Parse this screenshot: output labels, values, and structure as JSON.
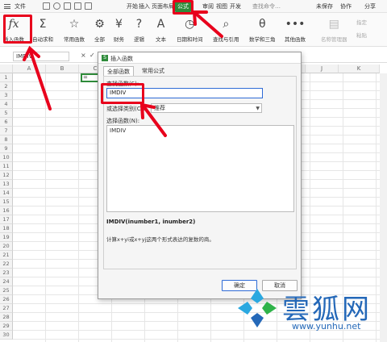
{
  "menubar": {
    "file": "文件",
    "tabs": [
      "开始",
      "插入",
      "页面布局",
      "公式",
      "审阅",
      "视图",
      "开发"
    ],
    "search_placeholder": "查找命令…",
    "unsaved": "未保存",
    "collab": "协作",
    "share": "分享"
  },
  "ribbon": {
    "buttons": [
      {
        "label": "插入函数",
        "icon": "fx-icon"
      },
      {
        "label": "自动求和",
        "icon": "sigma-icon"
      },
      {
        "label": "常用函数",
        "icon": "star-icon"
      },
      {
        "label": "全部",
        "icon": "gear-icon"
      },
      {
        "label": "财务",
        "icon": "finance-icon"
      },
      {
        "label": "逻辑",
        "icon": "logic-icon"
      },
      {
        "label": "文本",
        "icon": "text-icon"
      },
      {
        "label": "日期和时间",
        "icon": "clock-icon"
      },
      {
        "label": "查找与引用",
        "icon": "lookup-icon"
      },
      {
        "label": "数学和三角",
        "icon": "math-icon"
      },
      {
        "label": "其他函数",
        "icon": "more-icon"
      },
      {
        "label": "名称管理器",
        "icon": "name-manager-icon"
      },
      {
        "label": "指定",
        "icon": "assign-icon"
      },
      {
        "label": "粘贴",
        "icon": "paste-icon"
      }
    ]
  },
  "formula_bar": {
    "name_box": "IMDIV",
    "cancel": "×",
    "enter": "✓"
  },
  "grid": {
    "columns": [
      "A",
      "B",
      "C",
      "",
      "",
      "",
      "",
      "",
      "J",
      "K"
    ],
    "rows": [
      "1",
      "2",
      "3",
      "4",
      "5",
      "6",
      "7",
      "8",
      "9",
      "10",
      "11",
      "12",
      "13",
      "14",
      "15",
      "16",
      "17",
      "18",
      "19",
      "20",
      "21",
      "22",
      "23",
      "24",
      "25",
      "26",
      "27",
      "28",
      "29",
      "30"
    ],
    "active_cell_value": "="
  },
  "dialog": {
    "title": "插入函数",
    "tab_all": "全部函数",
    "tab_common": "常用公式",
    "search_label": "查找函数(S):",
    "search_value": "IMDIV",
    "category_label": "或选择类别(C):",
    "category_value": "推荐",
    "list_label": "选择函数(N):",
    "functions": [
      "IMDIV"
    ],
    "signature": "IMDIV(inumber1, inumber2)",
    "description": "计算x+yi或x+yj这两个形式表达的复数的商。",
    "ok": "确定",
    "cancel": "取消"
  },
  "watermark": {
    "brand": "雲狐网",
    "url": "www.yunhu.net"
  }
}
